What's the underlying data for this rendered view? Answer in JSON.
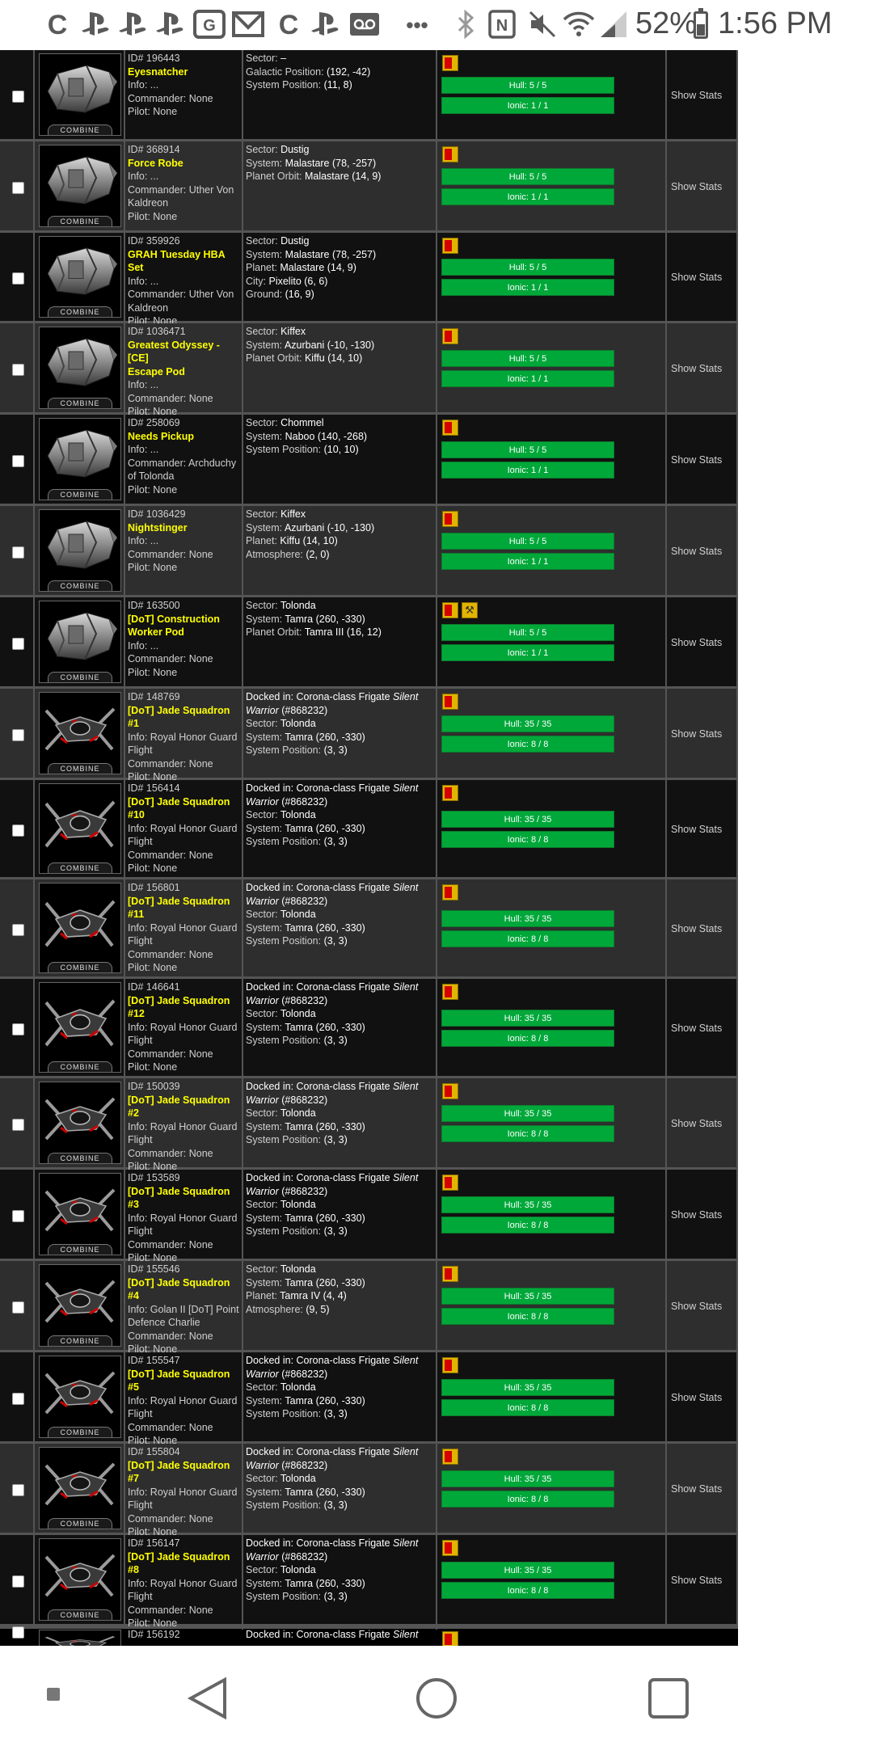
{
  "status_bar": {
    "left_icons": [
      "c-icon",
      "playstation-icon",
      "playstation-icon",
      "playstation-icon",
      "photo-icon",
      "mail-icon",
      "c-icon",
      "playstation-icon",
      "voicemail-icon"
    ],
    "more": "•••",
    "battery": "52%",
    "time": "1:56 PM"
  },
  "table": {
    "image_caption": "COMBINE",
    "show_stats_label": "Show Stats",
    "rows": [
      {
        "id": "ID# 196443",
        "name_lines": [
          "Eyesnatcher"
        ],
        "info_lines": [
          "Info: ...",
          "Commander: None",
          "Pilot: None"
        ],
        "location": [
          [
            "Sector: ",
            "–"
          ],
          [
            "Galactic Position: ",
            "(192, -42)"
          ],
          [
            "System Position: ",
            "(11, 8)"
          ]
        ],
        "hull": "Hull: 5 / 5",
        "ionic": "Ionic: 1 / 1",
        "ship": "pod",
        "tall": false,
        "extra_flag": false
      },
      {
        "id": "ID# 368914",
        "name_lines": [
          "Force Robe"
        ],
        "info_lines": [
          "Info: ...",
          "Commander: Uther Von",
          "Kaldreon",
          "Pilot: None"
        ],
        "location": [
          [
            "Sector: ",
            "Dustig"
          ],
          [
            "System: ",
            "Malastare (78, -257)"
          ],
          [
            "Planet Orbit: ",
            "Malastare (14, 9)"
          ]
        ],
        "hull": "Hull: 5 / 5",
        "ionic": "Ionic: 1 / 1",
        "ship": "pod",
        "tall": false,
        "extra_flag": false
      },
      {
        "id": "ID# 359926",
        "name_lines": [
          "GRAH Tuesday HBA Set"
        ],
        "info_lines": [
          "Info: ...",
          "Commander: Uther Von",
          "Kaldreon",
          "Pilot: None"
        ],
        "location": [
          [
            "Sector: ",
            "Dustig"
          ],
          [
            "System: ",
            "Malastare (78, -257)"
          ],
          [
            "Planet: ",
            "Malastare (14, 9)"
          ],
          [
            "City: ",
            "Pixelito (6, 6)"
          ],
          [
            "Ground: ",
            "(16, 9)"
          ]
        ],
        "hull": "Hull: 5 / 5",
        "ionic": "Ionic: 1 / 1",
        "ship": "pod",
        "tall": false,
        "extra_flag": false
      },
      {
        "id": "ID# 1036471",
        "name_lines": [
          "Greatest Odyssey - [CE]",
          "Escape Pod"
        ],
        "info_lines": [
          "Info: ...",
          "Commander: None",
          "Pilot: None"
        ],
        "location": [
          [
            "Sector: ",
            "Kiffex"
          ],
          [
            "System: ",
            "Azurbani (-10, -130)"
          ],
          [
            "Planet Orbit: ",
            "Kiffu (14, 10)"
          ]
        ],
        "hull": "Hull: 5 / 5",
        "ionic": "Ionic: 1 / 1",
        "ship": "pod",
        "tall": false,
        "extra_flag": false
      },
      {
        "id": "ID# 258069",
        "name_lines": [
          "Needs Pickup"
        ],
        "info_lines": [
          "Info: ...",
          "Commander: Archduchy",
          "of Tolonda",
          "Pilot: None"
        ],
        "location": [
          [
            "Sector: ",
            "Chommel"
          ],
          [
            "System: ",
            "Naboo (140, -268)"
          ],
          [
            "System Position: ",
            "(10, 10)"
          ]
        ],
        "hull": "Hull: 5 / 5",
        "ionic": "Ionic: 1 / 1",
        "ship": "pod",
        "tall": false,
        "extra_flag": false
      },
      {
        "id": "ID# 1036429",
        "name_lines": [
          "Nightstinger"
        ],
        "info_lines": [
          "Info: ...",
          "Commander: None",
          "Pilot: None"
        ],
        "location": [
          [
            "Sector: ",
            "Kiffex"
          ],
          [
            "System: ",
            "Azurbani (-10, -130)"
          ],
          [
            "Planet: ",
            "Kiffu (14, 10)"
          ],
          [
            "Atmosphere: ",
            "(2, 0)"
          ]
        ],
        "hull": "Hull: 5 / 5",
        "ionic": "Ionic: 1 / 1",
        "ship": "pod",
        "tall": false,
        "extra_flag": false
      },
      {
        "id": "ID# 163500",
        "name_lines": [
          "[DoT] Construction",
          "Worker Pod"
        ],
        "info_lines": [
          "Info: ...",
          "Commander: None",
          "Pilot: None"
        ],
        "location": [
          [
            "Sector: ",
            "Tolonda"
          ],
          [
            "System: ",
            "Tamra (260, -330)"
          ],
          [
            "Planet Orbit: ",
            "Tamra III (16, 12)"
          ]
        ],
        "hull": "Hull: 5 / 5",
        "ionic": "Ionic: 1 / 1",
        "ship": "pod",
        "tall": false,
        "extra_flag": true
      },
      {
        "id": "ID# 148769",
        "name_lines": [
          "[DoT] Jade Squadron #1"
        ],
        "info_lines": [
          "Info: Royal Honor Guard",
          "Flight",
          "Commander: None",
          "Pilot: None"
        ],
        "docked": [
          "Docked in: Corona-class Frigate ",
          "Silent",
          "Warrior",
          " (#868232)"
        ],
        "location": [
          [
            "Sector: ",
            "Tolonda"
          ],
          [
            "System: ",
            "Tamra (260, -330)"
          ],
          [
            "System Position: ",
            "(3, 3)"
          ]
        ],
        "hull": "Hull: 35 / 35",
        "ionic": "Ionic: 8 / 8",
        "ship": "fighter",
        "tall": false,
        "extra_flag": false
      },
      {
        "id": "ID# 156414",
        "name_lines": [
          "[DoT] Jade Squadron",
          "#10"
        ],
        "info_lines": [
          "Info: Royal Honor Guard",
          "Flight",
          "Commander: None",
          "Pilot: None"
        ],
        "docked": [
          "Docked in: Corona-class Frigate ",
          "Silent",
          "Warrior",
          " (#868232)"
        ],
        "location": [
          [
            "Sector: ",
            "Tolonda"
          ],
          [
            "System: ",
            "Tamra (260, -330)"
          ],
          [
            "System Position: ",
            "(3, 3)"
          ]
        ],
        "hull": "Hull: 35 / 35",
        "ionic": "Ionic: 8 / 8",
        "ship": "fighter",
        "tall": true,
        "extra_flag": false
      },
      {
        "id": "ID# 156801",
        "name_lines": [
          "[DoT] Jade Squadron",
          "#11"
        ],
        "info_lines": [
          "Info: Royal Honor Guard",
          "Flight",
          "Commander: None",
          "Pilot: None"
        ],
        "docked": [
          "Docked in: Corona-class Frigate ",
          "Silent",
          "Warrior",
          " (#868232)"
        ],
        "location": [
          [
            "Sector: ",
            "Tolonda"
          ],
          [
            "System: ",
            "Tamra (260, -330)"
          ],
          [
            "System Position: ",
            "(3, 3)"
          ]
        ],
        "hull": "Hull: 35 / 35",
        "ionic": "Ionic: 8 / 8",
        "ship": "fighter",
        "tall": true,
        "extra_flag": false
      },
      {
        "id": "ID# 146641",
        "name_lines": [
          "[DoT] Jade Squadron",
          "#12"
        ],
        "info_lines": [
          "Info: Royal Honor Guard",
          "Flight",
          "Commander: None",
          "Pilot: None"
        ],
        "docked": [
          "Docked in: Corona-class Frigate ",
          "Silent",
          "Warrior",
          " (#868232)"
        ],
        "location": [
          [
            "Sector: ",
            "Tolonda"
          ],
          [
            "System: ",
            "Tamra (260, -330)"
          ],
          [
            "System Position: ",
            "(3, 3)"
          ]
        ],
        "hull": "Hull: 35 / 35",
        "ionic": "Ionic: 8 / 8",
        "ship": "fighter",
        "tall": true,
        "extra_flag": false
      },
      {
        "id": "ID# 150039",
        "name_lines": [
          "[DoT] Jade Squadron #2"
        ],
        "info_lines": [
          "Info: Royal Honor Guard",
          "Flight",
          "Commander: None",
          "Pilot: None"
        ],
        "docked": [
          "Docked in: Corona-class Frigate ",
          "Silent",
          "Warrior",
          " (#868232)"
        ],
        "location": [
          [
            "Sector: ",
            "Tolonda"
          ],
          [
            "System: ",
            "Tamra (260, -330)"
          ],
          [
            "System Position: ",
            "(3, 3)"
          ]
        ],
        "hull": "Hull: 35 / 35",
        "ionic": "Ionic: 8 / 8",
        "ship": "fighter",
        "tall": false,
        "extra_flag": false
      },
      {
        "id": "ID# 153589",
        "name_lines": [
          "[DoT] Jade Squadron #3"
        ],
        "info_lines": [
          "Info: Royal Honor Guard",
          "Flight",
          "Commander: None",
          "Pilot: None"
        ],
        "docked": [
          "Docked in: Corona-class Frigate ",
          "Silent",
          "Warrior",
          " (#868232)"
        ],
        "location": [
          [
            "Sector: ",
            "Tolonda"
          ],
          [
            "System: ",
            "Tamra (260, -330)"
          ],
          [
            "System Position: ",
            "(3, 3)"
          ]
        ],
        "hull": "Hull: 35 / 35",
        "ionic": "Ionic: 8 / 8",
        "ship": "fighter",
        "tall": false,
        "extra_flag": false
      },
      {
        "id": "ID# 155546",
        "name_lines": [
          "[DoT] Jade Squadron #4"
        ],
        "info_lines": [
          "Info: Golan II [DoT] Point",
          "Defence Charlie",
          "Commander: None",
          "Pilot: None"
        ],
        "location": [
          [
            "Sector: ",
            "Tolonda"
          ],
          [
            "System: ",
            "Tamra (260, -330)"
          ],
          [
            "Planet: ",
            "Tamra IV (4, 4)"
          ],
          [
            "Atmosphere: ",
            "(9, 5)"
          ]
        ],
        "hull": "Hull: 35 / 35",
        "ionic": "Ionic: 8 / 8",
        "ship": "fighter",
        "tall": false,
        "extra_flag": false
      },
      {
        "id": "ID# 155547",
        "name_lines": [
          "[DoT] Jade Squadron #5"
        ],
        "info_lines": [
          "Info: Royal Honor Guard",
          "Flight",
          "Commander: None",
          "Pilot: None"
        ],
        "docked": [
          "Docked in: Corona-class Frigate ",
          "Silent",
          "Warrior",
          " (#868232)"
        ],
        "location": [
          [
            "Sector: ",
            "Tolonda"
          ],
          [
            "System: ",
            "Tamra (260, -330)"
          ],
          [
            "System Position: ",
            "(3, 3)"
          ]
        ],
        "hull": "Hull: 35 / 35",
        "ionic": "Ionic: 8 / 8",
        "ship": "fighter",
        "tall": false,
        "extra_flag": false
      },
      {
        "id": "ID# 155804",
        "name_lines": [
          "[DoT] Jade Squadron #7"
        ],
        "info_lines": [
          "Info: Royal Honor Guard",
          "Flight",
          "Commander: None",
          "Pilot: None"
        ],
        "docked": [
          "Docked in: Corona-class Frigate ",
          "Silent",
          "Warrior",
          " (#868232)"
        ],
        "location": [
          [
            "Sector: ",
            "Tolonda"
          ],
          [
            "System: ",
            "Tamra (260, -330)"
          ],
          [
            "System Position: ",
            "(3, 3)"
          ]
        ],
        "hull": "Hull: 35 / 35",
        "ionic": "Ionic: 8 / 8",
        "ship": "fighter",
        "tall": false,
        "extra_flag": false
      },
      {
        "id": "ID# 156147",
        "name_lines": [
          "[DoT] Jade Squadron #8"
        ],
        "info_lines": [
          "Info: Royal Honor Guard",
          "Flight",
          "Commander: None",
          "Pilot: None"
        ],
        "docked": [
          "Docked in: Corona-class Frigate ",
          "Silent",
          "Warrior",
          " (#868232)"
        ],
        "location": [
          [
            "Sector: ",
            "Tolonda"
          ],
          [
            "System: ",
            "Tamra (260, -330)"
          ],
          [
            "System Position: ",
            "(3, 3)"
          ]
        ],
        "hull": "Hull: 35 / 35",
        "ionic": "Ionic: 8 / 8",
        "ship": "fighter",
        "tall": false,
        "extra_flag": false
      },
      {
        "id": "ID# 156192",
        "name_lines": [],
        "info_lines": [],
        "docked": [
          "Docked in: Corona-class Frigate ",
          "Silent",
          "",
          ""
        ],
        "location": [],
        "hull": "",
        "ionic": "",
        "ship": "fighter",
        "tall": false,
        "extra_flag": false,
        "partial": true
      }
    ]
  },
  "colors": {
    "name": "#ffff00",
    "bar": "#00a83a",
    "row_dark": "#111111",
    "row_light": "#2e2e2e",
    "border": "#555555"
  },
  "nav_bar": {
    "buttons": [
      "recent-dot",
      "back",
      "home",
      "overview"
    ]
  }
}
